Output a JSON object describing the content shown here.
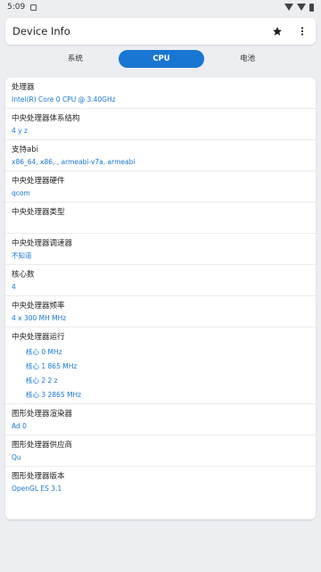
{
  "status_bar": {
    "time": "5:09"
  },
  "app_bar": {
    "title": "Device Info",
    "favorite_icon": "star-icon",
    "menu_icon": "more-vert-icon"
  },
  "tabs": [
    {
      "label": "系统",
      "active": false
    },
    {
      "label": "CPU",
      "active": true
    },
    {
      "label": "电池",
      "active": false
    }
  ],
  "rows": [
    {
      "label": "处理器",
      "value": "Intel(R) Core          0 CPU @ 3.40GHz"
    },
    {
      "label": "中央处理器体系结构",
      "value": "4 y          z"
    },
    {
      "label": "支持abi",
      "value": "x86_64, x86, ,          armeabi-v7a, armeabi"
    },
    {
      "label": "中央处理器硬件",
      "value": "qcom"
    },
    {
      "label": "中央处理器类型",
      "value": ""
    },
    {
      "label": "中央处理器调速器",
      "value": "不知道"
    },
    {
      "label": "核心数",
      "value": "4"
    },
    {
      "label": "中央处理器频率",
      "value": "4 x 300 MH          MHz"
    },
    {
      "label": "中央处理器运行",
      "cores": [
        "核心 0          MHz",
        "核心 1          865 MHz",
        "核心 2          2          z",
        "核心 3          2865 MHz"
      ]
    },
    {
      "label": "图形处理器渲染器",
      "value": "Ad          0"
    },
    {
      "label": "图形处理器供应商",
      "value": "Qu"
    },
    {
      "label": "图形处理器版本",
      "value": "OpenGL ES 3.1"
    }
  ],
  "colors": {
    "accent": "#1976d2",
    "background": "#eceef2",
    "card": "#ffffff"
  }
}
